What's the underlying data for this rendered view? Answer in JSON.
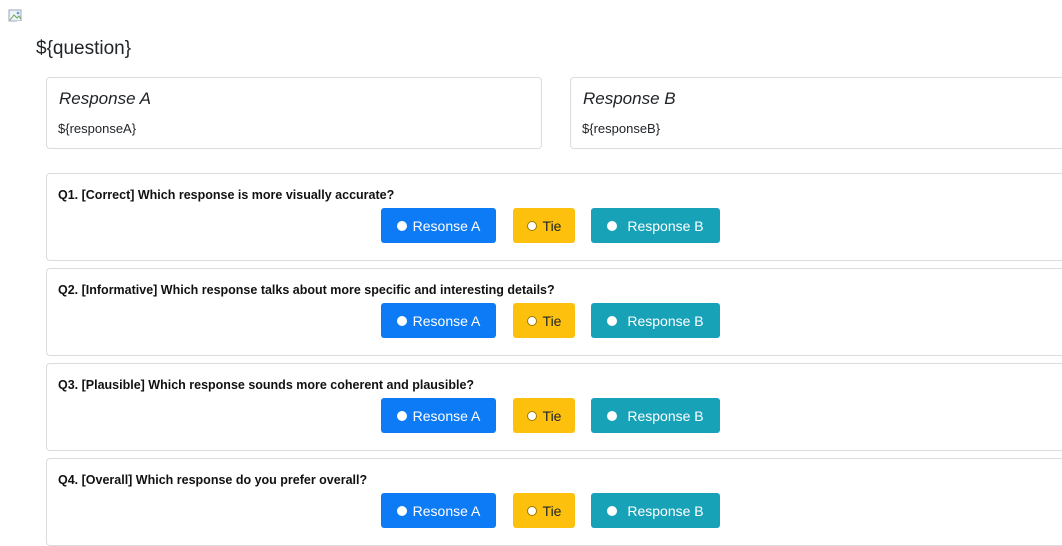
{
  "header": {
    "broken_image_icon": "broken-image-icon",
    "question": "${question}"
  },
  "responses": [
    {
      "title": "Response A",
      "body": "${responseA}"
    },
    {
      "title": "Response B",
      "body": "${responseB}"
    }
  ],
  "questions": [
    {
      "text": "Q1. [Correct] Which response is more visually accurate?",
      "option_a": "Resonse A",
      "option_tie": "Tie",
      "option_b": "Response B"
    },
    {
      "text": "Q2. [Informative] Which response talks about more specific and interesting details?",
      "option_a": "Resonse A",
      "option_tie": "Tie",
      "option_b": "Response B"
    },
    {
      "text": "Q3. [Plausible] Which response sounds more coherent and plausible?",
      "option_a": "Resonse A",
      "option_tie": "Tie",
      "option_b": "Response B"
    },
    {
      "text": "Q4. [Overall] Which response do you prefer overall?",
      "option_a": "Resonse A",
      "option_tie": "Tie",
      "option_b": "Response B"
    }
  ],
  "colors": {
    "primary": "#0d7bf5",
    "warning": "#fdc10d",
    "info": "#17a2b8"
  }
}
